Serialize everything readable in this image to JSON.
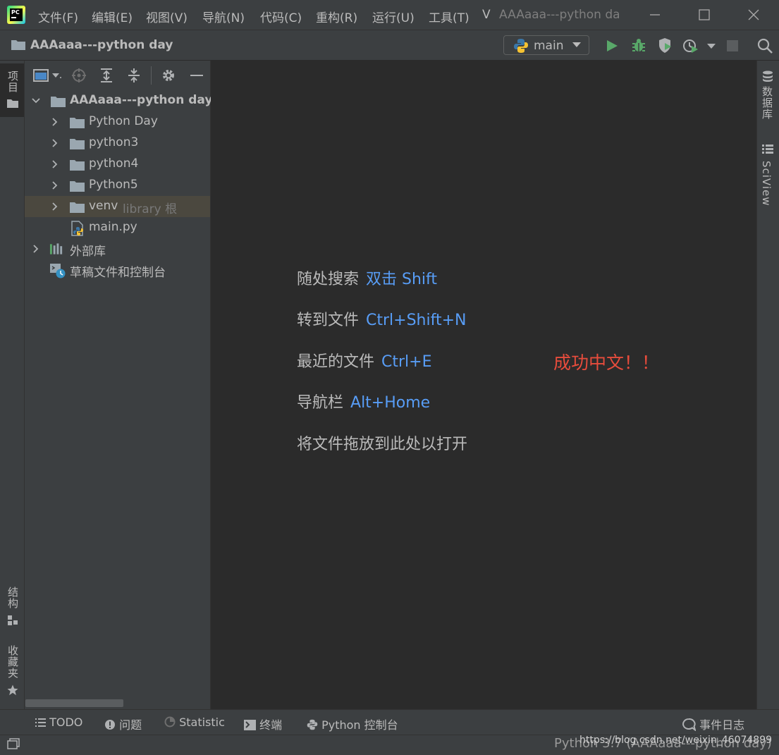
{
  "titlebar": {
    "menus": [
      "文件(F)",
      "编辑(E)",
      "视图(V)",
      "导航(N)",
      "代码(C)",
      "重构(R)",
      "运行(U)",
      "工具(T)",
      "V"
    ],
    "window_title": "AAAaaa---python da"
  },
  "navbar": {
    "project": "AAAaaa---python day",
    "run_config": "main"
  },
  "left_stripe": {
    "project_tab": "项目",
    "structure_tab": "结构",
    "favorites_tab": "收藏夹"
  },
  "right_stripe": {
    "database_tab": "数据库",
    "sciview_tab": "SciView"
  },
  "tree": {
    "root": "AAAaaa---python day",
    "items": [
      {
        "label": "Python Day"
      },
      {
        "label": "python3"
      },
      {
        "label": "python4"
      },
      {
        "label": "Python5"
      },
      {
        "label": "venv",
        "suffix": "library 根"
      },
      {
        "label": "main.py"
      }
    ],
    "external_libs": "外部库",
    "scratches": "草稿文件和控制台"
  },
  "editor": {
    "hints": [
      {
        "k": "随处搜索",
        "v": "双击 Shift"
      },
      {
        "k": "转到文件",
        "v": "Ctrl+Shift+N"
      },
      {
        "k": "最近的文件",
        "v": "Ctrl+E"
      },
      {
        "k": "导航栏",
        "v": "Alt+Home"
      },
      {
        "k": "将文件拖放到此处以打开",
        "v": ""
      }
    ],
    "annotation": "成功中文！！"
  },
  "bottom_tools": {
    "todo": "TODO",
    "problems": "问题",
    "statistic": "Statistic",
    "terminal": "终端",
    "python_console": "Python 控制台",
    "event_log": "事件日志"
  },
  "statusbar": {
    "interpreter": "Python 3.7 (AAAaaa---python day)",
    "watermark": "https://blog.csdn.net/weixin_46074899"
  },
  "colors": {
    "background": "#2b2b2b",
    "panel": "#3c3f41",
    "link": "#589df6",
    "annotation": "#e74c3c",
    "selection": "#4b483f"
  }
}
